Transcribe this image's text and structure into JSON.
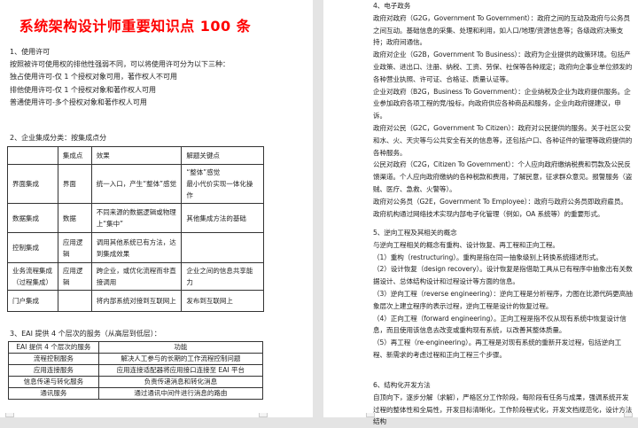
{
  "left_page": {
    "title": "系统架构设计师重要知识点 100 条",
    "section1": {
      "heading": "1、使用许可",
      "lines": [
        "按照被许可使用权的排他性强弱不同，可以将使用许可分为以下三种：",
        "独占使用许可-仅 1 个授权对象可用，著作权人不可用",
        "排他使用许可-仅 1 个授权对象和著作权人可用",
        "普通使用许可-多个授权对象和著作权人可用"
      ]
    },
    "section2": {
      "heading": "2、企业集成分类：按集成点分",
      "headers": [
        "",
        "集成点",
        "效果",
        "解题关键点"
      ],
      "rows": [
        [
          "界面集成",
          "界面",
          "统一入口，产生“整体”感觉",
          "“整体”感觉\n最小代价实现一体化操作"
        ],
        [
          "数据集成",
          "数据",
          "不同来源的数据逻辑或物理上“集中”",
          "其他集成方法的基础"
        ],
        [
          "控制集成",
          "应用逻辑",
          "调用其他系统已有方法，达到集成效果",
          ""
        ],
        [
          "业务流程集成\n（过程集成）",
          "应用逻辑",
          "跨企业，或优化流程而非直接调用",
          "企业之间的信息共享能力"
        ],
        [
          "门户集成",
          "",
          "将内部系统对接到互联网上",
          "发布到互联网上"
        ]
      ]
    },
    "section3": {
      "heading": "3、EAI 提供 4 个层次的服务（从高层到低层）：",
      "headers": [
        "EAI 提供 4 个层次的服务",
        "功能"
      ],
      "rows": [
        [
          "流程控制服务",
          "解决人工参与的长期的工作流程控制问题"
        ],
        [
          "应用连接服务",
          "应用连接适配器将应用接口连接至 EAI 平台"
        ],
        [
          "信息传递与转化服务",
          "负责传递消息和转化消息"
        ],
        [
          "通讯服务",
          "通过通讯中间件进行消息的路由"
        ]
      ]
    }
  },
  "right_page": {
    "section4": {
      "heading": "4、电子政务",
      "paragraphs": [
        "政府对政府（G2G，Government To Government）：政府之间的互动及政府与公务员之间互动。基础信息的采集、处理和利用，如人口/地理/资源信息等；各级政府决策支持；政府间通信。",
        "政府对企业（G2B，Government To Business）：政府为企业提供的政策环境。包括产业政策、进出口、注册、纳税、工资、劳保、社保等各种规定；政府向企事业单位颁发的各种营业执照、许可证、合格证、质量认证等。",
        "企业对政府（B2G，Business To Government）：企业纳税及企业为政府提供服务。企业参加政府各项工程的竞/投标，向政府供应各种商品和服务，企业向政府提建议，申诉。",
        "政府对公民（G2C，Government To Citizen）：政府对公民提供的服务。关于社区公安和水、火、天灾等与公共安全有关的信息等，还包括户口、各种证件的管理等政府提供的各种服务。",
        "公民对政府（C2G，Citizen To Government）：个人应向政府缴纳税费和罚款及公民反馈渠道。个人应向政府缴纳的各种税款和费用，了解民意，征求群众意见。报警服务（盗贼、医疗、急救、火警等）。",
        "政府对公务员（G2E，Government To Employee）：政府与政府公务员即政府雇员。政府机构通过网络技术实现内部电子化管理（例如，OA 系统等）的重要形式。"
      ]
    },
    "section5": {
      "heading": "5、逆向工程及其相关的概念",
      "paragraphs": [
        "与逆向工程相关的概念有重构、设计恢复、再工程和正向工程。",
        "（1）重构（restructuring）。重构是指在同一抽象级别上转换系统描述形式。",
        "（2）设计恢复（design recovery）。设计恢复是指借助工具从已有程序中抽象出有关数据设计、总体结构设计和过程设计等方面的信息。",
        "（3）逆向工程（reverse engineering）：逆向工程是分析程序，力图在比源代码更高抽象层次上建立程序的表示过程，逆向工程是设计的恢复过程。",
        "（4）正向工程（forward engineering）。正向工程是指不仅从现有系统中恢复设计信息，而且使用该信息去改变或重构现有系统，以改善其整体质量。",
        "（5）再工程（re-engineering）。再工程是对现有系统的重新开发过程，包括逆向工程、新需求的考虑过程和正向工程三个步骤。"
      ]
    },
    "section6": {
      "heading": "6、结构化开发方法",
      "paragraphs": [
        "自顶向下，逐步分解（求解），严格区分工作阶段，每阶段有任务与成果，强调系统开发过程的整体性和全局性，开发目标清晰化，工作阶段程式化，开发文档规范化，设计方法结构"
      ]
    }
  }
}
